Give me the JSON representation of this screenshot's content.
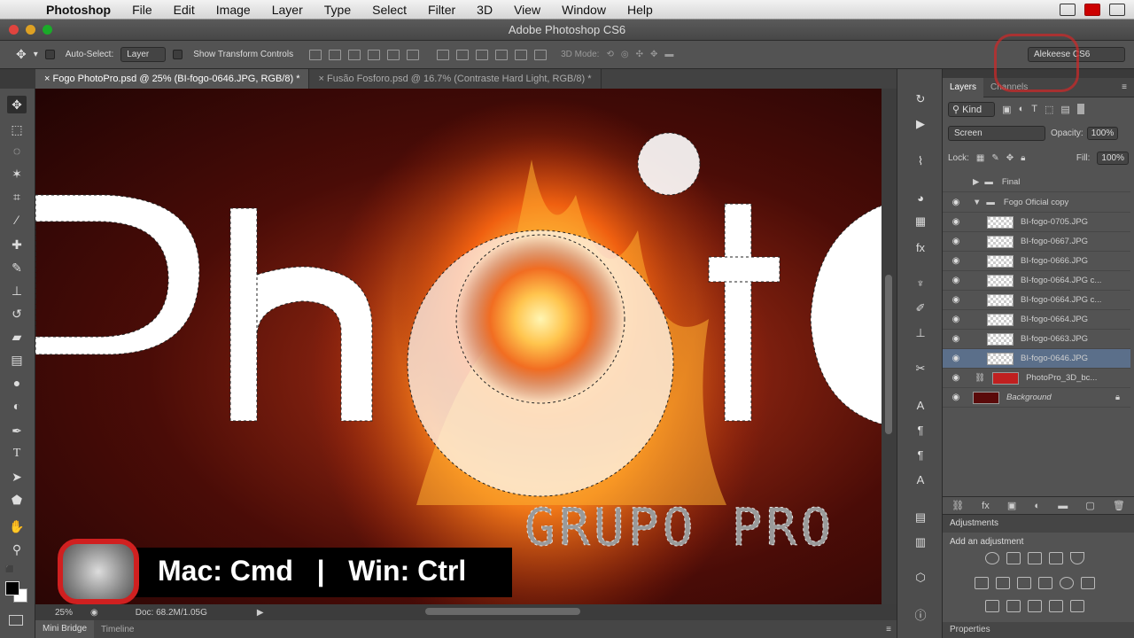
{
  "menubar": {
    "app_name": "Photoshop",
    "items": [
      "File",
      "Edit",
      "Image",
      "Layer",
      "Type",
      "Select",
      "Filter",
      "3D",
      "View",
      "Window",
      "Help"
    ]
  },
  "window": {
    "title": "Adobe Photoshop CS6"
  },
  "options": {
    "auto_select_label": "Auto-Select:",
    "auto_select_value": "Layer",
    "show_transform_label": "Show Transform Controls",
    "mode_3d_label": "3D Mode:",
    "workspace": "Alekeese CS6"
  },
  "doc_tabs": [
    {
      "label": "Fogo PhotoPro.psd @ 25% (BI-fogo-0646.JPG, RGB/8) *"
    },
    {
      "label": "Fusão Fosforo.psd @ 16.7% (Contraste Hard Light, RGB/8) *"
    }
  ],
  "canvas": {
    "letters": [
      "P",
      "h",
      "o",
      "t",
      "O"
    ],
    "brand_text": "GRUPO PRO",
    "banner_text": "Mac: Cmd   |   Win: Ctrl"
  },
  "status": {
    "zoom": "25%",
    "doc": "Doc: 68.2M/1.05G"
  },
  "bottom_tabs": [
    "Mini Bridge",
    "Timeline"
  ],
  "layers_panel": {
    "tabs": [
      "Layers",
      "Channels"
    ],
    "filter": "Kind",
    "blend_mode": "Screen",
    "opacity_label": "Opacity:",
    "opacity": "100%",
    "lock_label": "Lock:",
    "fill_label": "Fill:",
    "fill": "100%",
    "layers": [
      {
        "name": "Final"
      },
      {
        "name": "Fogo Oficial copy"
      },
      {
        "name": "BI-fogo-0705.JPG"
      },
      {
        "name": "BI-fogo-0667.JPG"
      },
      {
        "name": "BI-fogo-0666.JPG"
      },
      {
        "name": "BI-fogo-0664.JPG c..."
      },
      {
        "name": "BI-fogo-0664.JPG c..."
      },
      {
        "name": "BI-fogo-0664.JPG"
      },
      {
        "name": "BI-fogo-0663.JPG"
      },
      {
        "name": "BI-fogo-0646.JPG"
      },
      {
        "name": "PhotoPro_3D_bc..."
      },
      {
        "name": "Background"
      }
    ]
  },
  "adjustments": {
    "title": "Adjustments",
    "subtitle": "Add an adjustment"
  },
  "properties": {
    "title": "Properties"
  }
}
